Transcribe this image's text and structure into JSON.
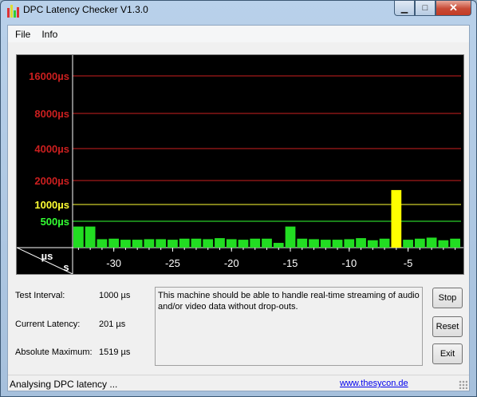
{
  "window": {
    "title": "DPC Latency Checker V1.3.0",
    "minimize": "▁",
    "maximize": "□",
    "close": "✕"
  },
  "menu": [
    "File",
    "Info"
  ],
  "chart_data": {
    "type": "bar",
    "ylabels": [
      {
        "label": "16000µs",
        "value": 16000,
        "color": "#cc1f1f"
      },
      {
        "label": "8000µs",
        "value": 8000,
        "color": "#cc1f1f"
      },
      {
        "label": "4000µs",
        "value": 4000,
        "color": "#cc1f1f"
      },
      {
        "label": "2000µs",
        "value": 2000,
        "color": "#cc1f1f"
      },
      {
        "label": "1000µs",
        "value": 1000,
        "color": "#ffff33"
      },
      {
        "label": "500µs",
        "value": 500,
        "color": "#33ff33"
      }
    ],
    "corner_top": "µs",
    "corner_bottom": "s",
    "xticks": [
      -30,
      -25,
      -20,
      -15,
      -10,
      -5
    ],
    "x_range": [
      -33,
      -1
    ],
    "values_us": [
      400,
      400,
      160,
      170,
      150,
      150,
      160,
      160,
      150,
      170,
      170,
      160,
      180,
      160,
      150,
      170,
      170,
      90,
      400,
      170,
      160,
      150,
      150,
      160,
      180,
      140,
      170,
      1519,
      150,
      170,
      190,
      140,
      170
    ],
    "colors": {
      "normal": "#22dd22",
      "warning": "#ffff00"
    }
  },
  "info": {
    "test_interval_label": "Test Interval:",
    "test_interval_value": "1000 µs",
    "current_latency_label": "Current Latency:",
    "current_latency_value": "201 µs",
    "absolute_max_label": "Absolute Maximum:",
    "absolute_max_value": "1519 µs"
  },
  "message": "This machine should be able to handle real-time streaming of audio and/or video data without drop-outs.",
  "buttons": {
    "stop": "Stop",
    "reset": "Reset",
    "exit": "Exit"
  },
  "status": {
    "text": "Analysing DPC latency ...",
    "link": "www.thesycon.de"
  }
}
